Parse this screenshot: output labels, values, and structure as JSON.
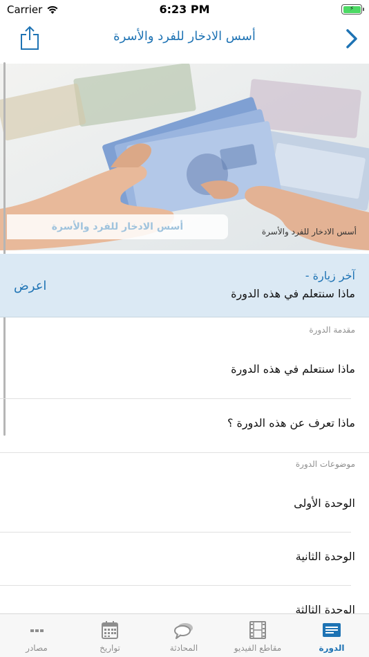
{
  "status": {
    "carrier": "Carrier",
    "time": "6:23 PM"
  },
  "nav": {
    "title": "أسس الادخار للفرد والأسرة",
    "share_icon": "share-icon",
    "back_icon": "chevron-right-icon"
  },
  "hero": {
    "banner_text": "أسس الادخار للفرد والأسرة",
    "caption": "أسس الادخار للفرد والأسرة"
  },
  "last_visit": {
    "title": "آخر زيارة -",
    "lesson": "ماذا سنتعلم في هذه الدورة",
    "action": "اعرض"
  },
  "intro": {
    "header": "مقدمة الدورة",
    "items": [
      {
        "label": "ماذا سنتعلم في هذه الدورة"
      },
      {
        "label": "ماذا تعرف عن هذه الدورة ؟"
      }
    ]
  },
  "topics": {
    "header": "موضوعات الدورة",
    "items": [
      {
        "label": "الوحدة الأولى"
      },
      {
        "label": "الوحدة الثانية"
      },
      {
        "label": "الوحدة الثالثة"
      }
    ]
  },
  "tabs": [
    {
      "label": "الدورة",
      "icon": "course-icon",
      "active": true
    },
    {
      "label": "مقاطع الفيديو",
      "icon": "film-icon",
      "active": false
    },
    {
      "label": "المحادثة",
      "icon": "chat-icon",
      "active": false
    },
    {
      "label": "تواريخ",
      "icon": "calendar-icon",
      "active": false
    },
    {
      "label": "مصادر",
      "icon": "more-icon",
      "active": false
    }
  ],
  "colors": {
    "accent": "#1e73b4",
    "highlight": "#dbe9f4",
    "battery": "#4cd964"
  }
}
